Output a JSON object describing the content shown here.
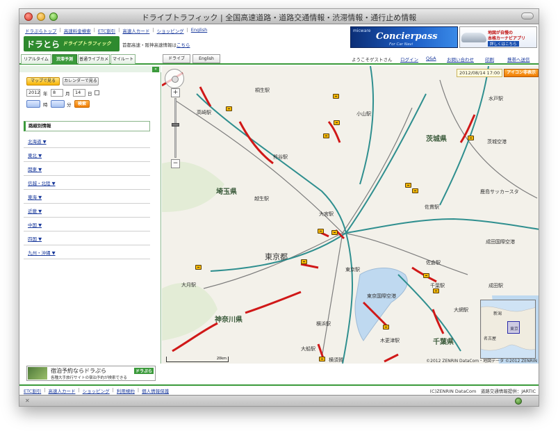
{
  "window": {
    "title": "ドライブトラフィック | 全国高速道路・道路交通情報・渋滞情報・通行止め情報"
  },
  "toplinks": [
    "ドラぷらトップ",
    "高速料金検索",
    "ETC割引",
    "高速人カード",
    "ショッピング",
    "English"
  ],
  "logo": {
    "main": "ドラとら",
    "sub": "ドライブトラフィック"
  },
  "shutoku_notice": {
    "text": "首都高速・阪神高速情報は",
    "link": "こちら"
  },
  "ads": {
    "concierpass": {
      "brand": "micware",
      "title": "Concierpass",
      "subtitle": "For Car Navi",
      "tag": "コンシェルパス"
    },
    "navi": {
      "line1": "地図が自慢の",
      "line2": "本格カーナビアプリ",
      "cta": "詳しくはこちら"
    }
  },
  "tabs": [
    {
      "label": "リアルタイム",
      "active": false
    },
    {
      "label": "渋滞予測",
      "active": true
    },
    {
      "label": "普通ライブカメラ",
      "active": false
    },
    {
      "label": "マイルート",
      "active": false
    }
  ],
  "mode_buttons": [
    "ドライブ",
    "English"
  ],
  "header_right": {
    "welcome": "ようこそゲストさん",
    "login": "ログイン",
    "qa": "Q&A",
    "contact": "お問い合わせ",
    "print": "印刷",
    "mobile": "携帯へ送信"
  },
  "sidebar": {
    "btn_map": "マップで見る",
    "btn_calendar": "カレンダーで見る",
    "year": "2012",
    "year_label": "年",
    "month": "8",
    "month_label": "月",
    "day": "14",
    "day_label": "日",
    "hour": "",
    "hour_label": "時",
    "minute": "",
    "minute_label": "分",
    "search_btn": "検索",
    "rosen_title": "路線別情報",
    "regions": [
      "北海道 ▼",
      "東北 ▼",
      "関東 ▼",
      "信越・北陸 ▼",
      "東海 ▼",
      "近畿 ▼",
      "中国 ▼",
      "四国 ▼",
      "九州・沖縄 ▼"
    ]
  },
  "map": {
    "datetime": "2012/08/14 17:00",
    "icon_toggle": "アイコン非表示",
    "labels": {
      "kiryu": "桐生駅",
      "mito": "水戸駅",
      "takasaki": "高崎駅",
      "oyama": "小山駅",
      "ibaraki": "茨城県",
      "kumagaya": "熊谷駅",
      "saitama": "埼玉県",
      "koshigaya": "越生駅",
      "omiya": "大宮駅",
      "sawara": "佐貫駅",
      "kashima": "鹿島サッカースタ",
      "tokyo_to": "東京都",
      "tokyo_st": "東京駅",
      "narita": "成田国際空港",
      "sakura": "佐倉駅",
      "otsuki": "大月駅",
      "chiba": "千葉駅",
      "haneda": "東京国際空港",
      "narita_st": "成田駅",
      "kanagawa": "神奈川県",
      "yokohama": "横浜駅",
      "ohara": "大網駅",
      "ofuna": "大船駅",
      "kisarazu": "木更津駅",
      "chiba_ken": "千葉県",
      "yokosuka": "横須賀",
      "ibaraki_airport": "茨城空港"
    },
    "minimap": {
      "niigata": "新潟",
      "nagoya": "名古屋",
      "tokyo": "東京"
    },
    "scale": "20km",
    "copyright": "©2012 ZENRIN DataCom・地図データ ©2012 ZENRIN"
  },
  "bottom_banner": {
    "title": "宿泊予約ならドラぷら",
    "sub": "各種大手旅行サイトの宿泊予約が検索できる",
    "badge": "ドラぷら"
  },
  "footer": {
    "links": [
      "ETC割引",
      "高速人カード",
      "ショッピング",
      "利用規約",
      "個人情報保護"
    ],
    "credit": "(C)ZENRIN DataCom　道路交通情報提供：JARTIC"
  },
  "colors": {
    "brand_green": "#3b9a3b",
    "accent_orange": "#f07c00",
    "congestion_red": "#d01818",
    "link_blue": "#1a3a9c"
  }
}
